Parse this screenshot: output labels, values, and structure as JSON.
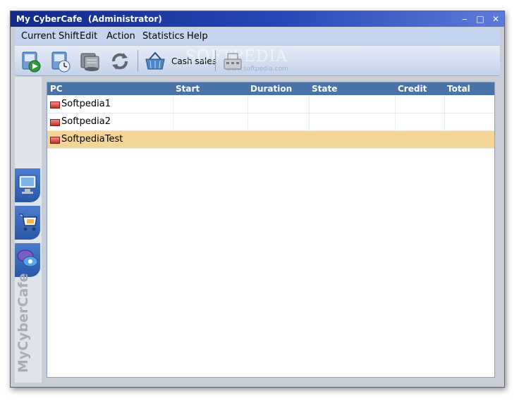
{
  "window": {
    "title": "My CyberCafe  (Administrator)"
  },
  "window_controls": {
    "minimize": "‒",
    "maximize": "□",
    "close": "✕"
  },
  "menu": [
    "Current Shift",
    "Edit",
    "Action",
    "Statistics",
    "Help"
  ],
  "toolbar": {
    "buttons": [
      "start-shift-icon",
      "clock-shift-icon",
      "report-stack-icon",
      "refresh-icon",
      "cash-basket-icon",
      "cash-register-icon"
    ],
    "cash_sales_label": "Cash sales",
    "watermark": "SOFTPEDIA",
    "watermark_small": "www.softpedia.com"
  },
  "sidebar": {
    "buttons": [
      "monitor-icon",
      "shopping-cart-icon",
      "chat-bubble-icon"
    ],
    "brand": "MyCyberCafe"
  },
  "table": {
    "columns": [
      "PC",
      "Start",
      "Duration",
      "State",
      "Credit",
      "Total"
    ],
    "rows": [
      {
        "pc": "Softpedia1",
        "start": "",
        "duration": "",
        "state": "",
        "credit": "",
        "total": "",
        "selected": false
      },
      {
        "pc": "Softpedia2",
        "start": "",
        "duration": "",
        "state": "",
        "credit": "",
        "total": "",
        "selected": false
      },
      {
        "pc": "SoftpediaTest",
        "start": "",
        "duration": "",
        "state": "",
        "credit": "",
        "total": "",
        "selected": true
      }
    ]
  },
  "colors": {
    "title_bar": "#1e3ca6",
    "header": "#4a74a8",
    "selected_row": "#f2d597",
    "sidebar_button": "#2f5fb5"
  }
}
